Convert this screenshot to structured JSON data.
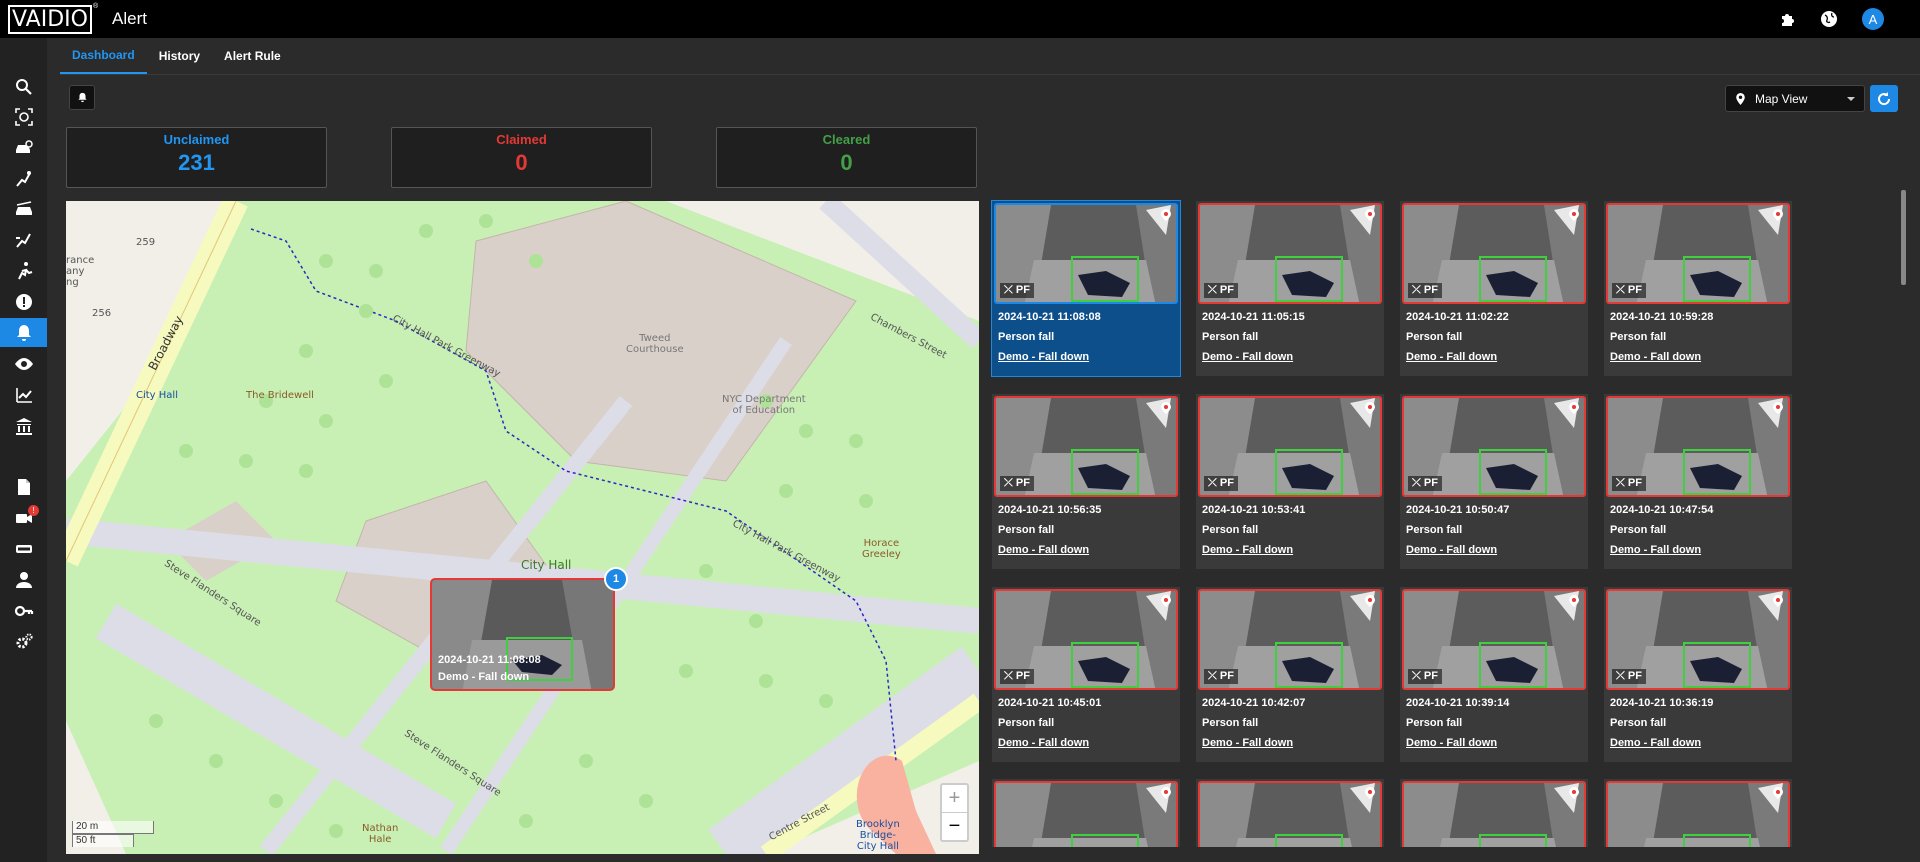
{
  "app": {
    "logo": "VAIDIO",
    "logo_mark": "®",
    "title": "Alert",
    "avatar": "A"
  },
  "topbar": {
    "icons": [
      "puzzle-icon",
      "globe-icon"
    ]
  },
  "sidebar": {
    "items": [
      {
        "name": "search-icon"
      },
      {
        "name": "face-scan-icon"
      },
      {
        "name": "vehicle-search-icon"
      },
      {
        "name": "run-icon"
      },
      {
        "name": "car-icon"
      },
      {
        "name": "person-motion-icon"
      },
      {
        "name": "person-running-icon"
      },
      {
        "name": "exclamation-icon"
      },
      {
        "name": "bell-icon",
        "active": true
      },
      {
        "name": "eye-icon"
      },
      {
        "name": "chart-icon"
      },
      {
        "name": "bank-icon"
      },
      {
        "name": "document-icon"
      },
      {
        "name": "camera-icon",
        "badge": "!"
      },
      {
        "name": "license-icon"
      },
      {
        "name": "user-icon"
      },
      {
        "name": "key-icon"
      },
      {
        "name": "settings-icon"
      }
    ]
  },
  "tabs": [
    {
      "label": "Dashboard",
      "active": true
    },
    {
      "label": "History"
    },
    {
      "label": "Alert Rule"
    }
  ],
  "view_select": {
    "value": "Map View"
  },
  "stats": [
    {
      "label": "Unclaimed",
      "value": "231",
      "color": "#2196f3"
    },
    {
      "label": "Claimed",
      "value": "0",
      "color": "#e53935"
    },
    {
      "label": "Cleared",
      "value": "0",
      "color": "#43a047"
    }
  ],
  "map": {
    "labels": {
      "city_hall_park_greenway": "City Hall Park Greenway",
      "city_hall_park_greenway_2": "City Hall Park Greenway",
      "tweed": "Tweed\nCourthouse",
      "nyc_doe": "NYC Department\nof Education",
      "chambers": "Chambers Street",
      "broadway": "Broadway",
      "city_hall_station": "City Hall",
      "bridewell": "The Bridewell",
      "city_hall": "City Hall",
      "horace": "Horace\nGreeley",
      "steve1": "Steve Flanders Square",
      "steve2": "Steve Flanders Square",
      "centre": "Centre Street",
      "brooklyn": "Brooklyn\nBridge-\nCity Hall",
      "nathan": "Nathan\nHale",
      "n259": "259",
      "n256": "256",
      "insurance": "rance\nany\nng"
    },
    "popup": {
      "timestamp": "2024-10-21 11:08:08",
      "camera": "Demo - Fall down"
    },
    "cluster_count": "1",
    "zoom_in": "+",
    "zoom_out": "−",
    "scale_m": "20 m",
    "scale_ft": "50 ft"
  },
  "alerts": [
    {
      "timestamp": "2024-10-21 11:08:08",
      "type": "Person fall",
      "camera": "Demo - Fall down",
      "tag": "PF",
      "selected": true
    },
    {
      "timestamp": "2024-10-21 11:05:15",
      "type": "Person fall",
      "camera": "Demo - Fall down",
      "tag": "PF"
    },
    {
      "timestamp": "2024-10-21 11:02:22",
      "type": "Person fall",
      "camera": "Demo - Fall down",
      "tag": "PF"
    },
    {
      "timestamp": "2024-10-21 10:59:28",
      "type": "Person fall",
      "camera": "Demo - Fall down",
      "tag": "PF"
    },
    {
      "timestamp": "2024-10-21 10:56:35",
      "type": "Person fall",
      "camera": "Demo - Fall down",
      "tag": "PF"
    },
    {
      "timestamp": "2024-10-21 10:53:41",
      "type": "Person fall",
      "camera": "Demo - Fall down",
      "tag": "PF"
    },
    {
      "timestamp": "2024-10-21 10:50:47",
      "type": "Person fall",
      "camera": "Demo - Fall down",
      "tag": "PF"
    },
    {
      "timestamp": "2024-10-21 10:47:54",
      "type": "Person fall",
      "camera": "Demo - Fall down",
      "tag": "PF"
    },
    {
      "timestamp": "2024-10-21 10:45:01",
      "type": "Person fall",
      "camera": "Demo - Fall down",
      "tag": "PF"
    },
    {
      "timestamp": "2024-10-21 10:42:07",
      "type": "Person fall",
      "camera": "Demo - Fall down",
      "tag": "PF"
    },
    {
      "timestamp": "2024-10-21 10:39:14",
      "type": "Person fall",
      "camera": "Demo - Fall down",
      "tag": "PF"
    },
    {
      "timestamp": "2024-10-21 10:36:19",
      "type": "Person fall",
      "camera": "Demo - Fall down",
      "tag": "PF"
    },
    {
      "timestamp": "",
      "type": "",
      "camera": "",
      "tag": ""
    },
    {
      "timestamp": "",
      "type": "",
      "camera": "",
      "tag": ""
    },
    {
      "timestamp": "",
      "type": "",
      "camera": "",
      "tag": ""
    },
    {
      "timestamp": "",
      "type": "",
      "camera": "",
      "tag": ""
    }
  ]
}
